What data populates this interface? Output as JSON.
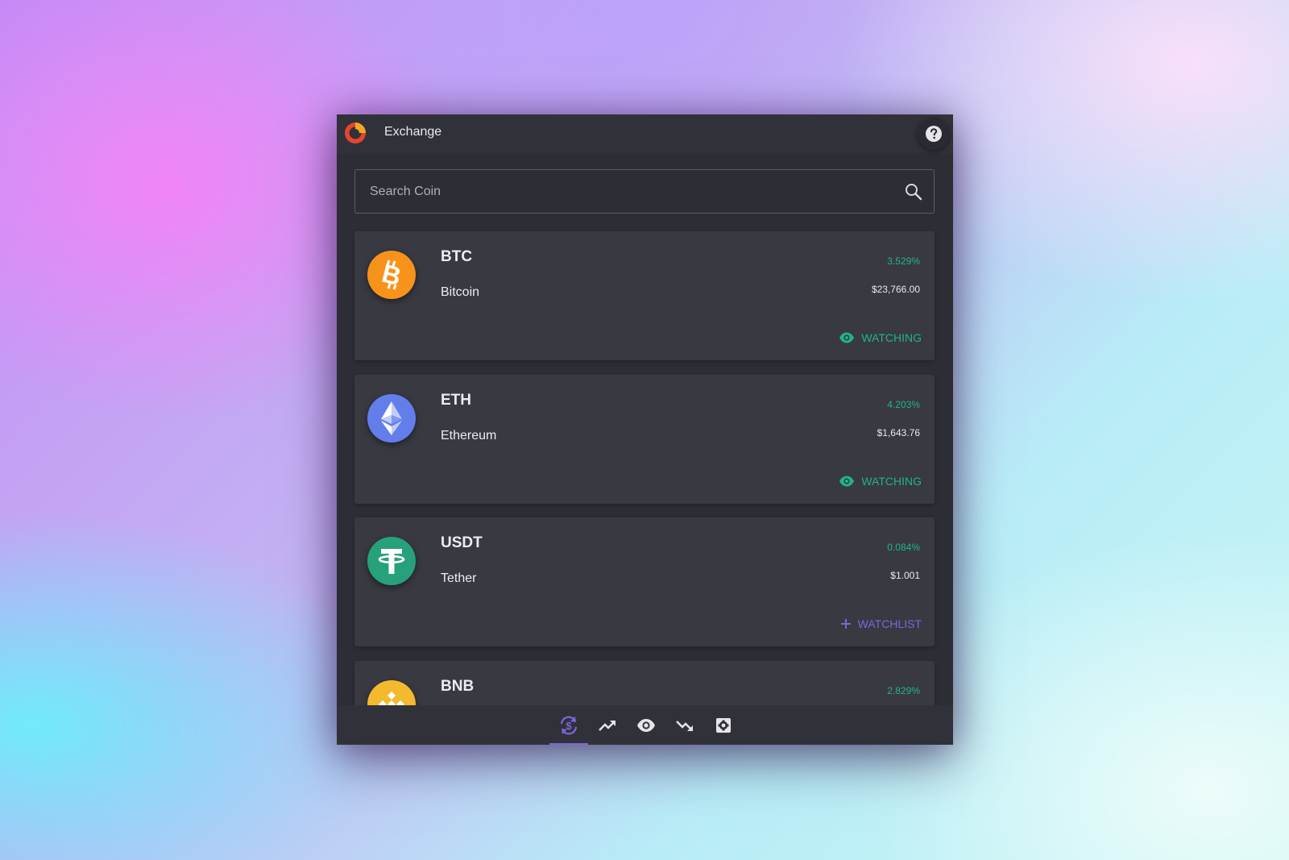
{
  "app": {
    "title": "Exchange"
  },
  "search": {
    "placeholder": "Search Coin"
  },
  "coins": [
    {
      "symbol": "BTC",
      "name": "Bitcoin",
      "change": "3.529%",
      "price": "$23,766.00",
      "watch_label": "WATCHING",
      "watching": true,
      "color": "#f7931a"
    },
    {
      "symbol": "ETH",
      "name": "Ethereum",
      "change": "4.203%",
      "price": "$1,643.76",
      "watch_label": "WATCHING",
      "watching": true,
      "color": "#627eea"
    },
    {
      "symbol": "USDT",
      "name": "Tether",
      "change": "0.084%",
      "price": "$1.001",
      "watch_label": "WATCHLIST",
      "watching": false,
      "color": "#26a17b"
    },
    {
      "symbol": "BNB",
      "name": "",
      "change": "2.829%",
      "price": "",
      "watch_label": "",
      "watching": false,
      "color": "#f3ba2f"
    }
  ],
  "nav": [
    {
      "icon": "exchange-icon",
      "active": true
    },
    {
      "icon": "trending-up-icon",
      "active": false
    },
    {
      "icon": "eye-icon",
      "active": false
    },
    {
      "icon": "trending-down-icon",
      "active": false
    },
    {
      "icon": "settings-icon",
      "active": false
    }
  ],
  "colors": {
    "accent": "#7b66d9",
    "positive": "#1fb585",
    "panel": "#2d2d35",
    "card": "#393942"
  }
}
